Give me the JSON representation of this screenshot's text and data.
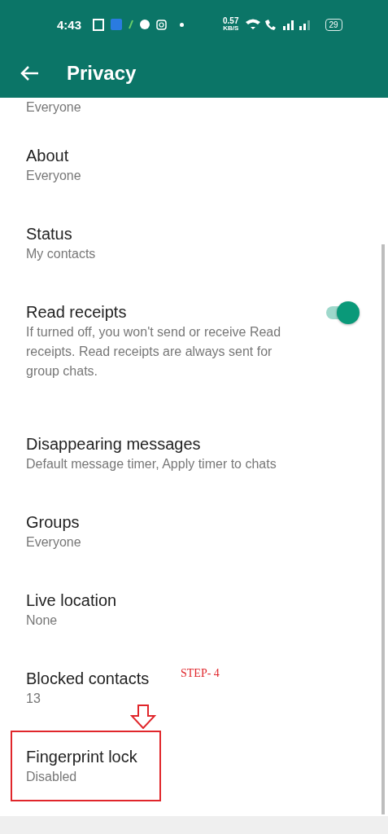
{
  "status_bar": {
    "time": "4:43",
    "speed": "0.57",
    "speed_unit": "KB/S",
    "battery": "29"
  },
  "app_bar": {
    "title": "Privacy"
  },
  "settings": [
    {
      "kind": "cut",
      "subtitle": "Everyone"
    },
    {
      "kind": "plain",
      "title": "About",
      "subtitle": "Everyone"
    },
    {
      "kind": "plain",
      "title": "Status",
      "subtitle": "My contacts"
    },
    {
      "kind": "toggle",
      "title": "Read receipts",
      "subtitle": "If turned off, you won't send or receive Read receipts. Read receipts are always sent for group chats.",
      "on": true
    },
    {
      "kind": "plain",
      "title": "Disappearing messages",
      "subtitle": "Default message timer, Apply timer to chats"
    },
    {
      "kind": "plain",
      "title": "Groups",
      "subtitle": "Everyone"
    },
    {
      "kind": "plain",
      "title": "Live location",
      "subtitle": "None"
    },
    {
      "kind": "plain",
      "title": "Blocked contacts",
      "subtitle": "13"
    },
    {
      "kind": "plain",
      "title": "Fingerprint lock",
      "subtitle": "Disabled",
      "highlighted": true
    }
  ],
  "annotation": {
    "label": "STEP- 4"
  }
}
